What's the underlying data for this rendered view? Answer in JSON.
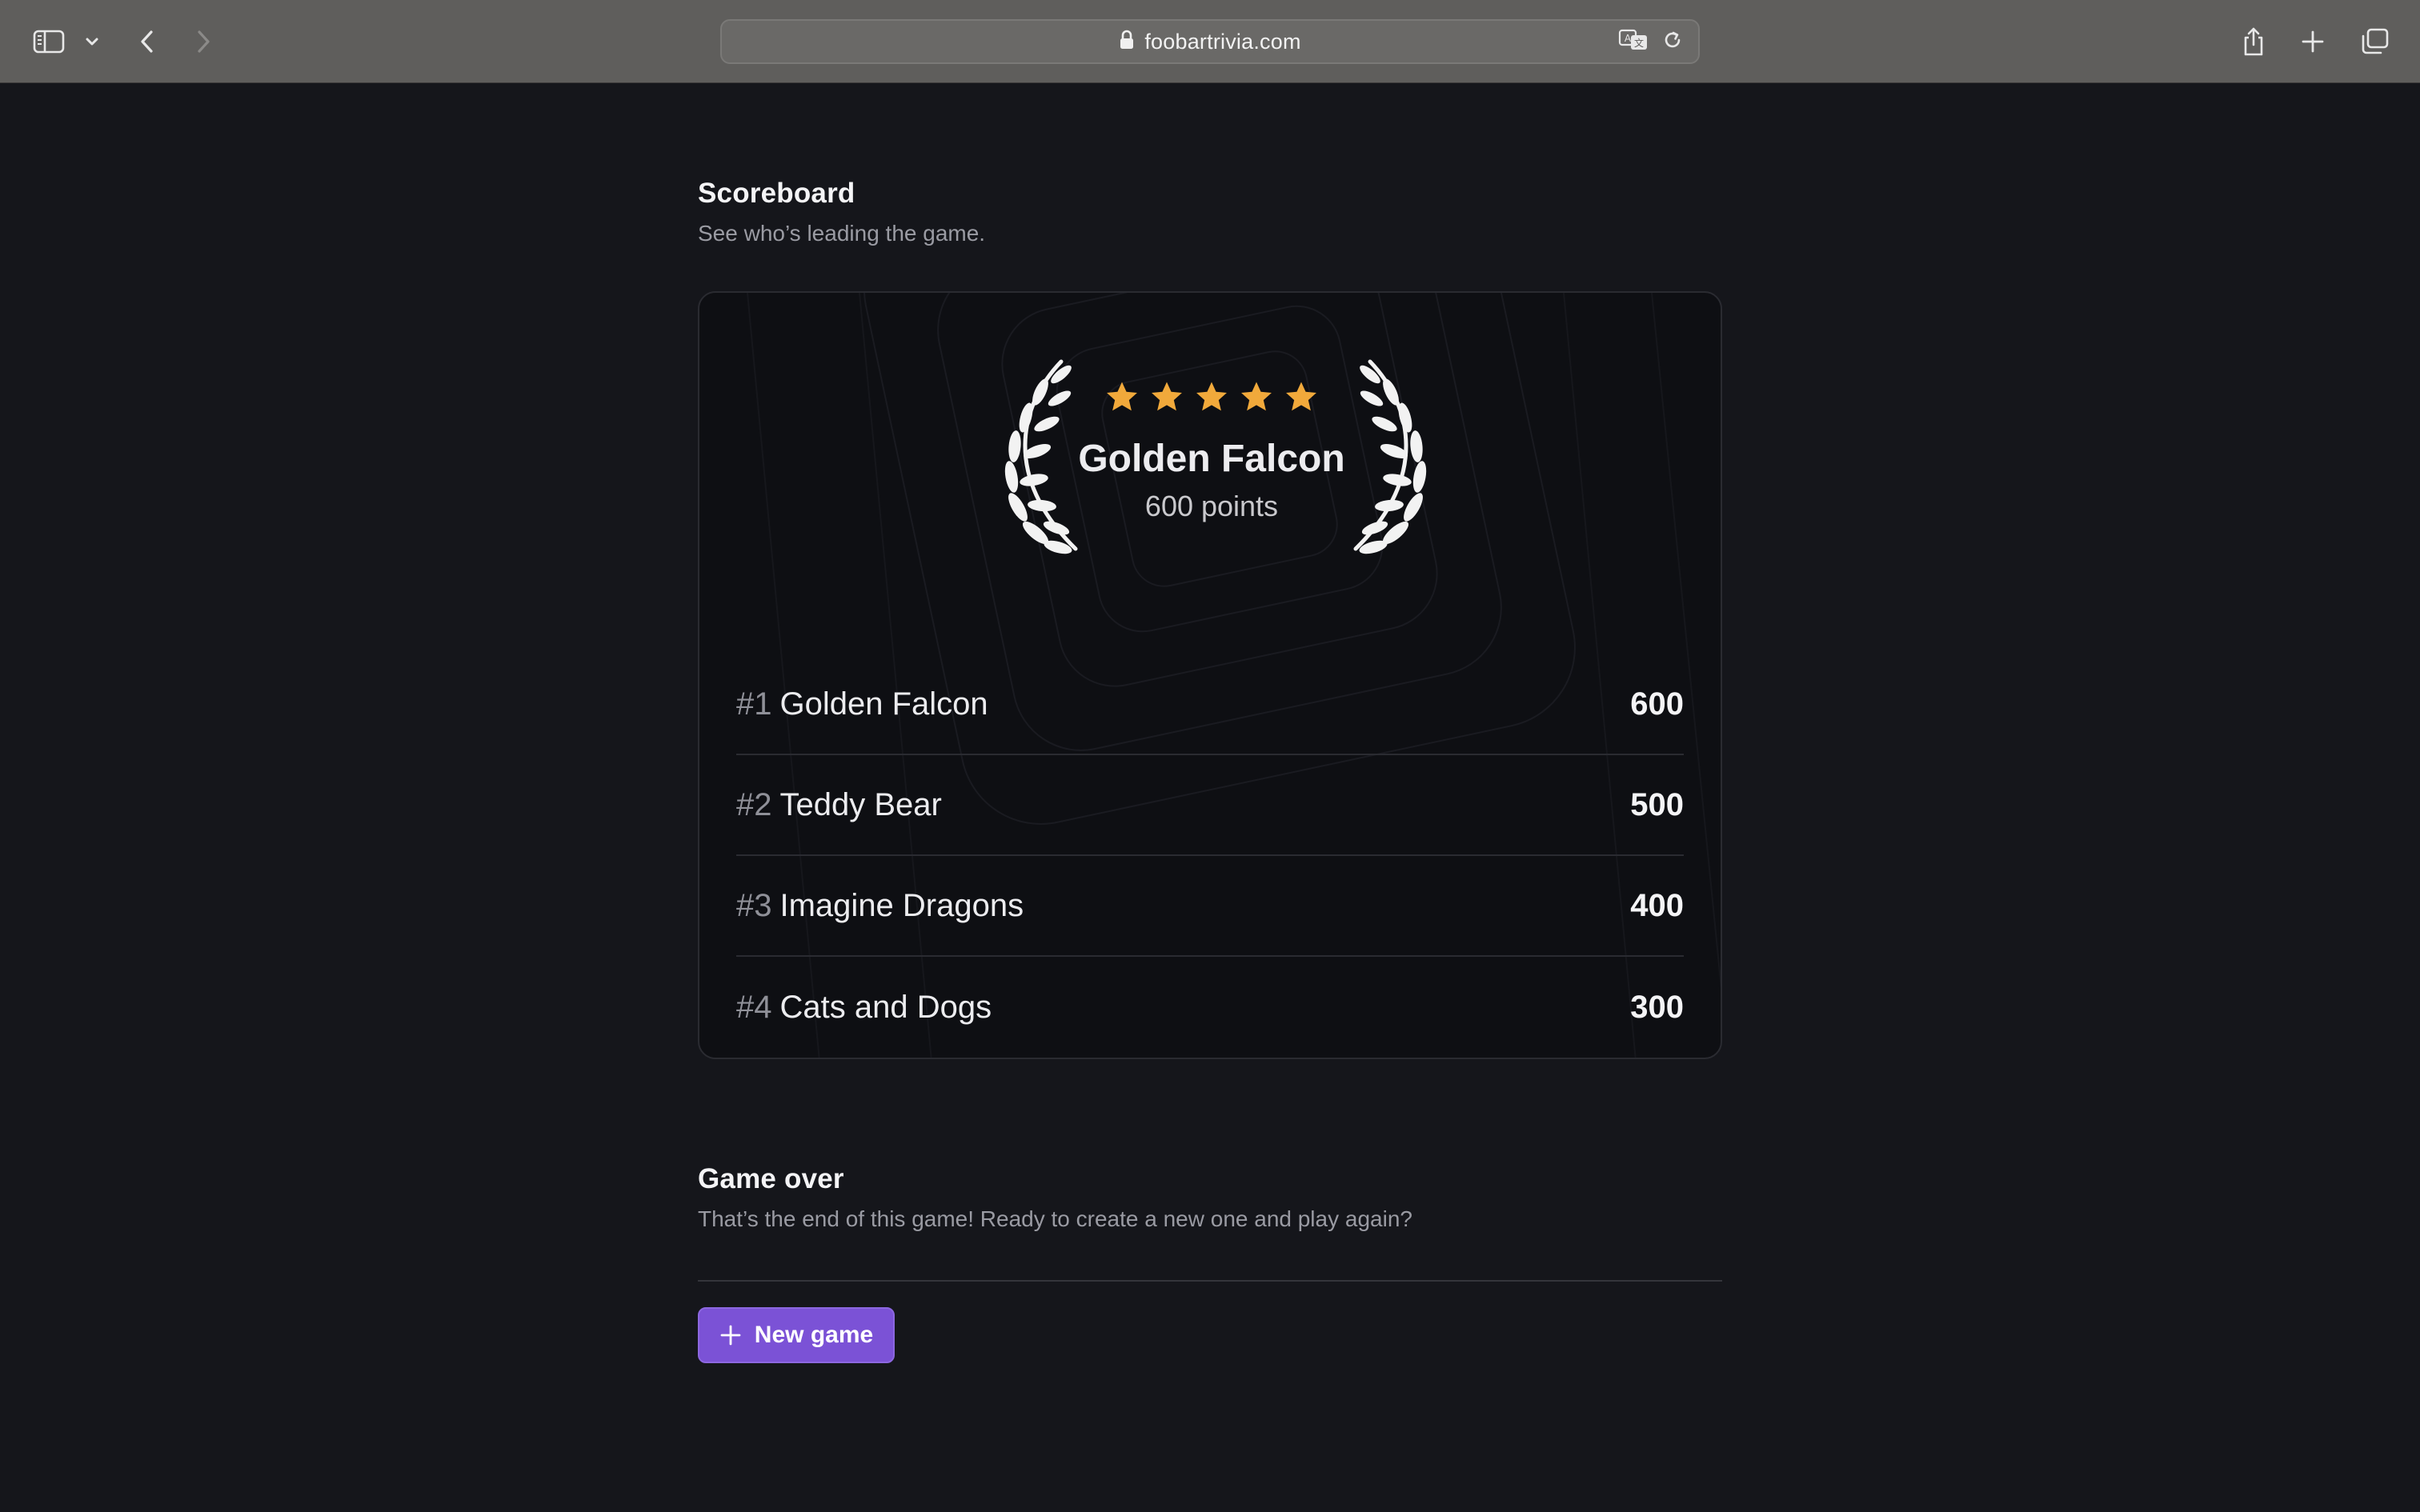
{
  "browser": {
    "url": "foobartrivia.com",
    "icons": {
      "sidebar": "sidebar-icon",
      "tab_group_menu": "chevron-down-icon",
      "back": "chevron-left-icon",
      "forward": "chevron-right-icon",
      "secure": "lock-icon",
      "translate": "translate-icon",
      "reload": "reload-icon",
      "share": "share-icon",
      "new_tab": "plus-icon",
      "tab_overview": "tabs-icon"
    }
  },
  "scoreboard": {
    "title": "Scoreboard",
    "subtitle": "See who’s leading the game.",
    "winner": {
      "name": "Golden Falcon",
      "points_label": "600 points",
      "stars": 5
    },
    "rows": [
      {
        "rank": "#1",
        "team": "Golden Falcon",
        "score": "600"
      },
      {
        "rank": "#2",
        "team": "Teddy Bear",
        "score": "500"
      },
      {
        "rank": "#3",
        "team": "Imagine Dragons",
        "score": "400"
      },
      {
        "rank": "#4",
        "team": "Cats and Dogs",
        "score": "300"
      }
    ]
  },
  "game_over": {
    "title": "Game over",
    "subtitle": "That’s the end of this game! Ready to create a new one and play again?",
    "new_game_label": "New game"
  },
  "colors": {
    "page_bg": "#15161b",
    "card_bg": "#0e0f13",
    "accent": "#7b52d6",
    "star": "#f1a93b"
  }
}
